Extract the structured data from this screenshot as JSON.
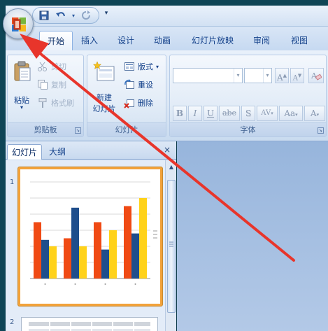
{
  "quick_access": {
    "save_icon": "save-icon",
    "undo_icon": "undo-icon",
    "redo_icon": "redo-icon",
    "more_glyph": "▾"
  },
  "tabs": [
    {
      "label": "开始",
      "active": true
    },
    {
      "label": "插入",
      "active": false
    },
    {
      "label": "设计",
      "active": false
    },
    {
      "label": "动画",
      "active": false
    },
    {
      "label": "幻灯片放映",
      "active": false
    },
    {
      "label": "审阅",
      "active": false
    },
    {
      "label": "视图",
      "active": false
    }
  ],
  "clipboard": {
    "paste_label": "粘贴",
    "cut_label": "剪切",
    "copy_label": "复制",
    "format_painter_label": "格式刷",
    "group_label": "剪贴板"
  },
  "slides_group": {
    "new_slide_line1": "新建",
    "new_slide_line2": "幻灯片",
    "layout_label": "版式",
    "reset_label": "重设",
    "delete_label": "删除",
    "group_label": "幻灯片"
  },
  "font_group": {
    "font_name_value": "",
    "font_size_value": "",
    "grow_label": "A",
    "shrink_label": "A",
    "bold": "B",
    "italic": "I",
    "underline": "U",
    "strike": "abe",
    "shadow": "S",
    "spacing": "AV",
    "case": "Aa",
    "color": "A",
    "group_label": "字体"
  },
  "panel": {
    "tab_slides": "幻灯片",
    "tab_outline": "大纲",
    "close_glyph": "×",
    "slide1_number": "1",
    "slide2_number": "2"
  },
  "colors": {
    "annotation_arrow": "#e8352b",
    "selection_border": "#f2a23a",
    "bar_navy": "#1f4e8c",
    "bar_orange": "#f04a14",
    "bar_yellow": "#ffd21a"
  },
  "chart_data": {
    "type": "bar",
    "categories": [
      "1",
      "2",
      "3",
      "4"
    ],
    "series": [
      {
        "values": [
          3.5,
          2.5,
          3.5,
          4.5
        ]
      },
      {
        "values": [
          2.4,
          4.4,
          1.8,
          2.8
        ]
      },
      {
        "values": [
          2.0,
          2.0,
          3.0,
          5.0
        ]
      }
    ],
    "series_colors": [
      "#f04a14",
      "#1f4e8c",
      "#ffd21a"
    ],
    "ylim": [
      0,
      6
    ]
  }
}
